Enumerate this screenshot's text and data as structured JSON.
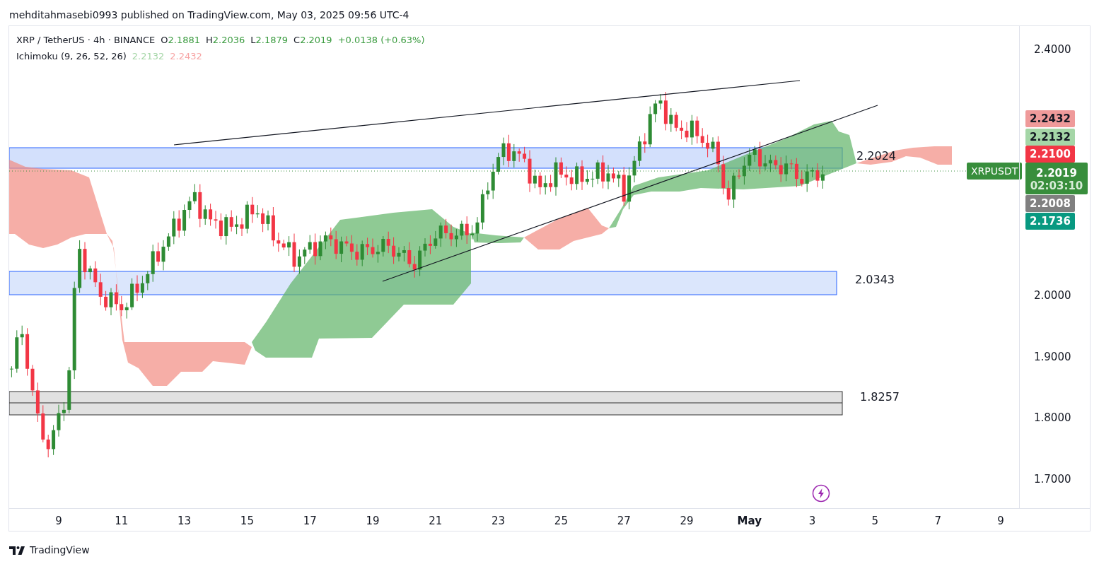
{
  "attribution": "mehditahmasebi0993 published on TradingView.com, May 03, 2025 09:56 UTC-4",
  "legend": {
    "symbol": "XRP / TetherUS · 4h · BINANCE",
    "ohlc": [
      {
        "label": "O",
        "value": "2.1881"
      },
      {
        "label": "H",
        "value": "2.2036"
      },
      {
        "label": "L",
        "value": "2.1879"
      },
      {
        "label": "C",
        "value": "2.2019"
      }
    ],
    "change": "+0.0138 (+0.63%)",
    "indicator": "Ichimoku (9, 26, 52, 26)",
    "indicator_values": [
      {
        "text": "2.2132",
        "color": "#a5d6a7"
      },
      {
        "text": "2.2432",
        "color": "#f7a5a5"
      }
    ]
  },
  "zones": [
    {
      "label": "2.2024"
    },
    {
      "label": "2.0343"
    },
    {
      "label": "1.8257"
    }
  ],
  "symbol_badge": "XRPUSDT",
  "price_axis": {
    "ticks": [
      "2.4000",
      "2.0000",
      "1.9000",
      "1.8000",
      "1.7000"
    ],
    "badges": [
      {
        "text": "2.2432",
        "color": "#ef9a9a"
      },
      {
        "text": "2.2132",
        "color": "#a5d6a7"
      },
      {
        "text": "2.2100",
        "color": "#f23645"
      },
      {
        "text": "2.2019",
        "countdown": "02:03:10",
        "color": "#388e3c"
      },
      {
        "text": "2.2008",
        "color": "#808080"
      },
      {
        "text": "2.1736",
        "color": "#089981"
      }
    ]
  },
  "date_axis": [
    {
      "label": "9",
      "emphasis": false
    },
    {
      "label": "11",
      "emphasis": false
    },
    {
      "label": "13",
      "emphasis": false
    },
    {
      "label": "15",
      "emphasis": false
    },
    {
      "label": "17",
      "emphasis": false
    },
    {
      "label": "19",
      "emphasis": false
    },
    {
      "label": "21",
      "emphasis": false
    },
    {
      "label": "23",
      "emphasis": false
    },
    {
      "label": "25",
      "emphasis": false
    },
    {
      "label": "27",
      "emphasis": false
    },
    {
      "label": "29",
      "emphasis": false
    },
    {
      "label": "May",
      "emphasis": true
    },
    {
      "label": "3",
      "emphasis": false
    },
    {
      "label": "5",
      "emphasis": false
    },
    {
      "label": "7",
      "emphasis": false
    },
    {
      "label": "9",
      "emphasis": false
    }
  ],
  "footer": {
    "brand": "TradingView"
  }
}
